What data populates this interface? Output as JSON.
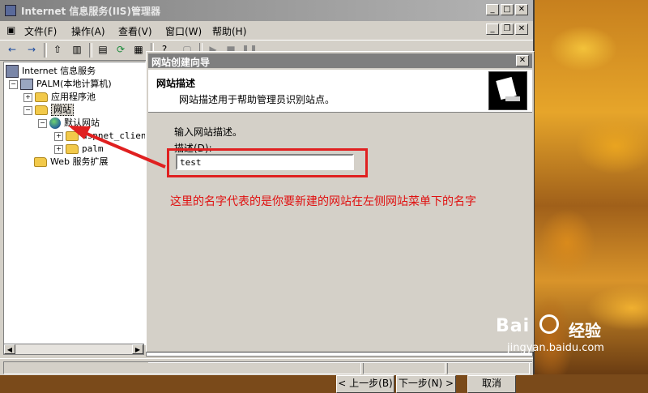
{
  "window": {
    "title": "Internet 信息服务(IIS)管理器"
  },
  "menubar": {
    "items": [
      "文件(F)",
      "操作(A)",
      "查看(V)",
      "窗口(W)",
      "帮助(H)"
    ]
  },
  "tree": {
    "root": "Internet 信息服务",
    "computer": "PALM(本地计算机)",
    "app_pools": "应用程序池",
    "websites": "网站",
    "default_site": "默认网站",
    "child1": "aspnet_client",
    "child2": "palm",
    "web_ext": "Web 服务扩展"
  },
  "wizard": {
    "title": "网站创建向导",
    "header_title": "网站描述",
    "header_subtitle": "网站描述用于帮助管理员识别站点。",
    "prompt": "输入网站描述。",
    "field_label": "描述(D):",
    "field_value": "test",
    "buttons": {
      "back": "< 上一步(B)",
      "next": "下一步(N) >",
      "cancel": "取消"
    }
  },
  "annotation": {
    "text": "这里的名字代表的是你要新建的网站在左侧网站菜单下的名字",
    "color": "#e01010"
  },
  "watermark": {
    "brand_left": "Bai",
    "brand_right": "经验",
    "url": "jingyan.baidu.com"
  },
  "colors": {
    "titlebar_inactive": "#7f7f7f",
    "highlight": "#e02020"
  }
}
